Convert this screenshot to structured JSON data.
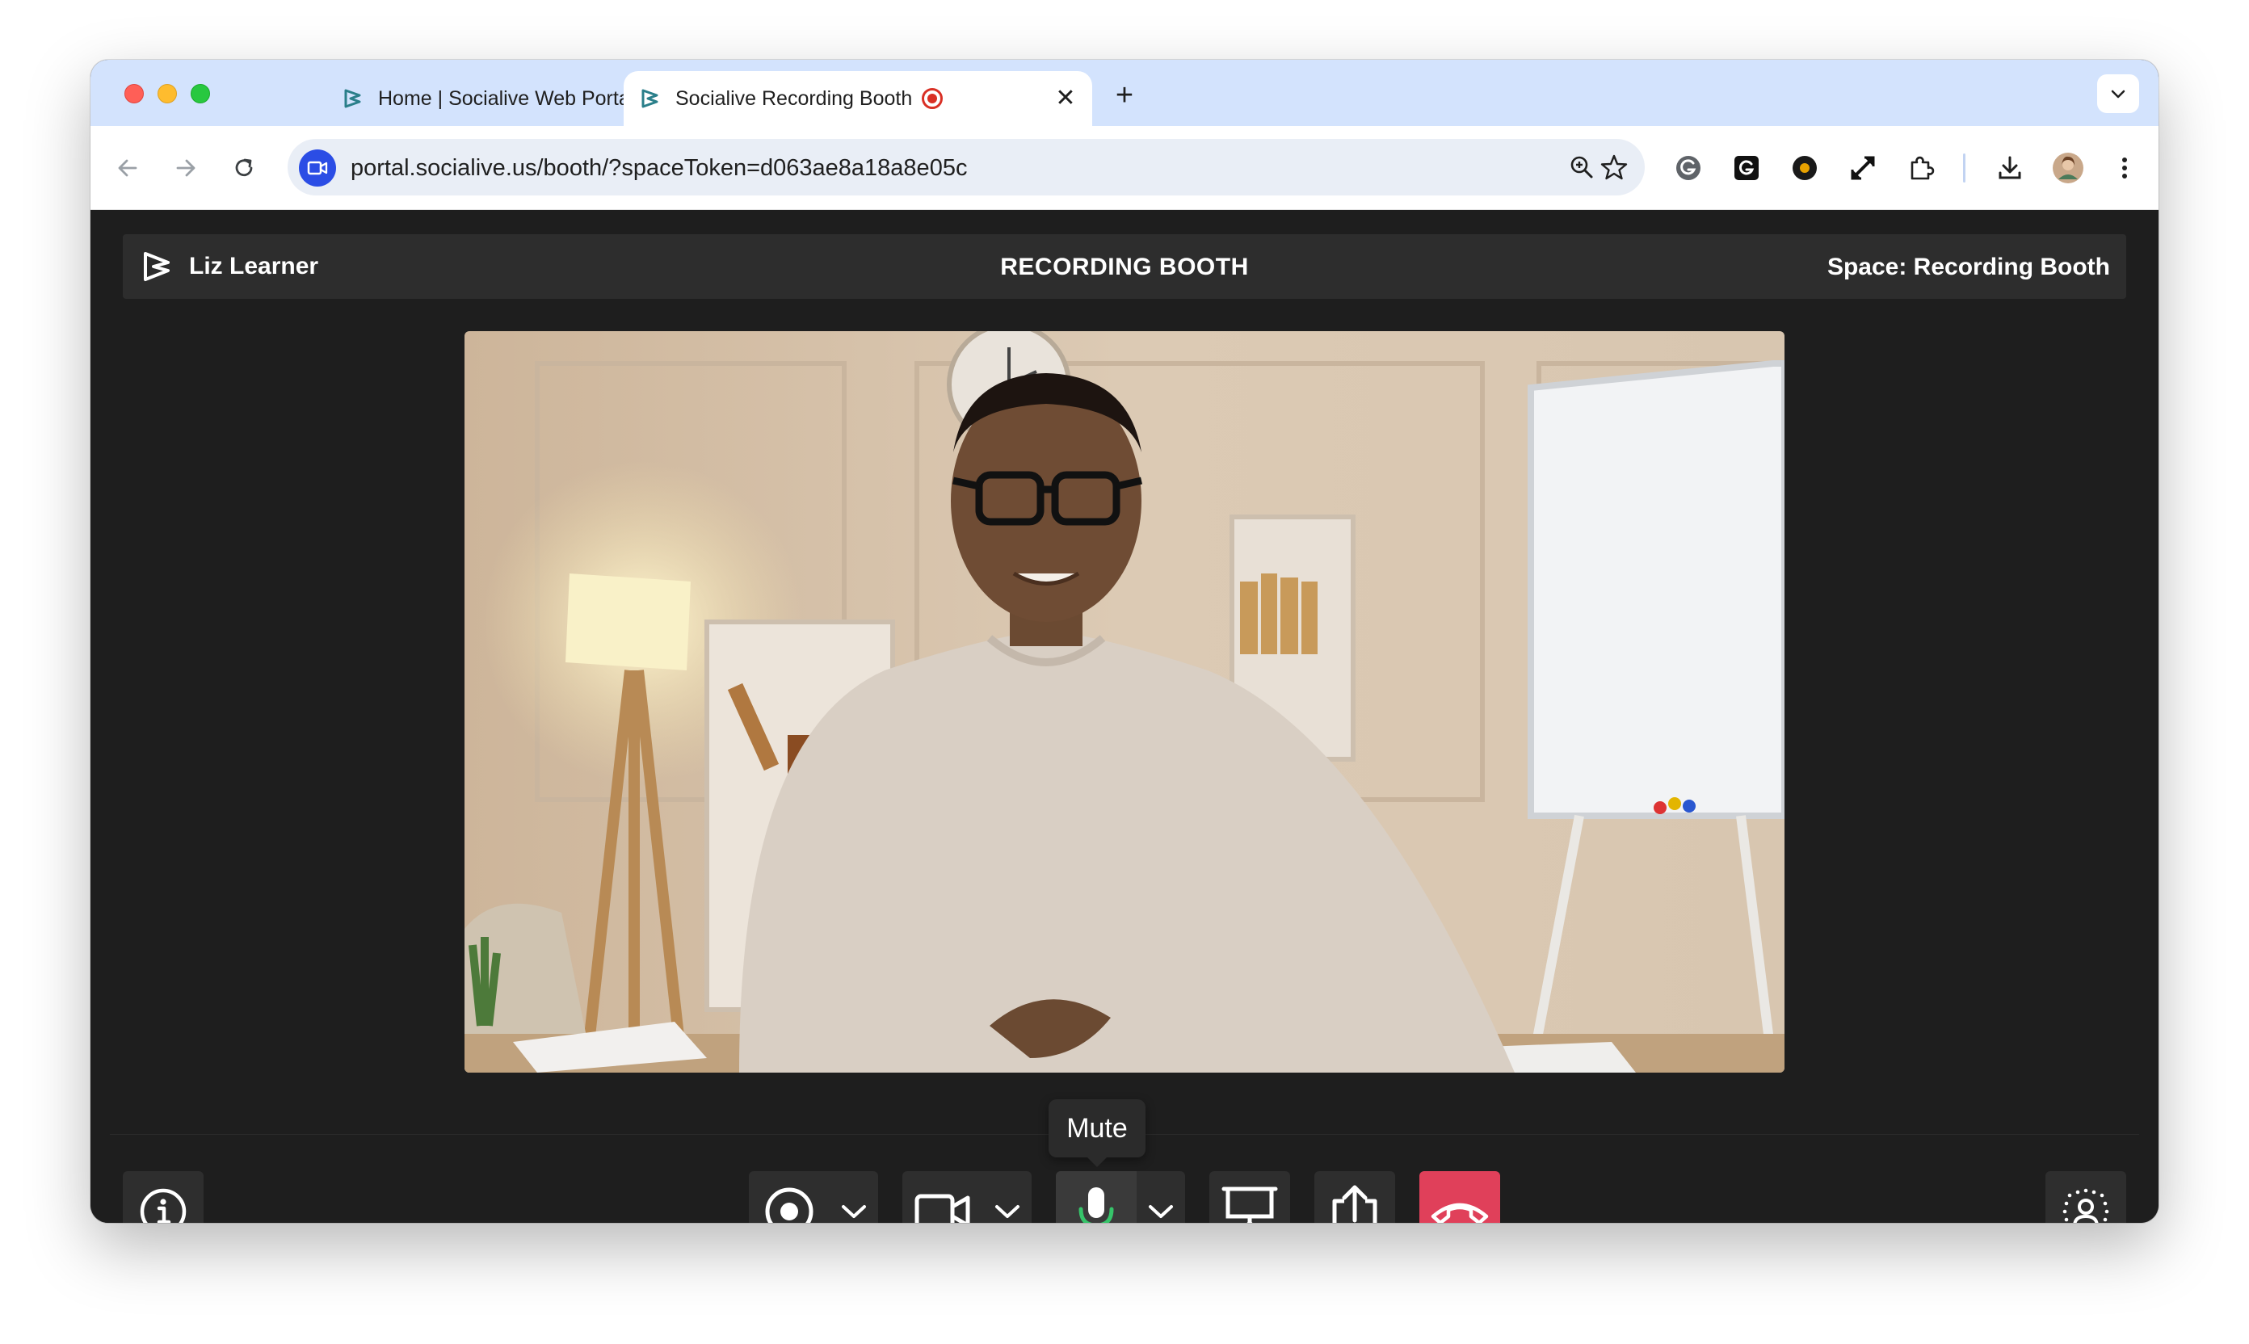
{
  "browser": {
    "tabs": [
      {
        "title": "Home | Socialive Web Portal",
        "active": false
      },
      {
        "title": "Socialive Recording Booth",
        "active": true,
        "recording": true
      }
    ],
    "url": "portal.socialive.us/booth/?spaceToken=d063ae8a18a8e05c"
  },
  "app": {
    "user_name": "Liz Learner",
    "page_title": "RECORDING BOOTH",
    "space_label": "Space: Recording Booth"
  },
  "controls": {
    "mute_tooltip": "Mute"
  },
  "colors": {
    "accent_blue": "#2b4de5",
    "end_call_red": "#e0405a",
    "mic_green": "#36c46a"
  }
}
